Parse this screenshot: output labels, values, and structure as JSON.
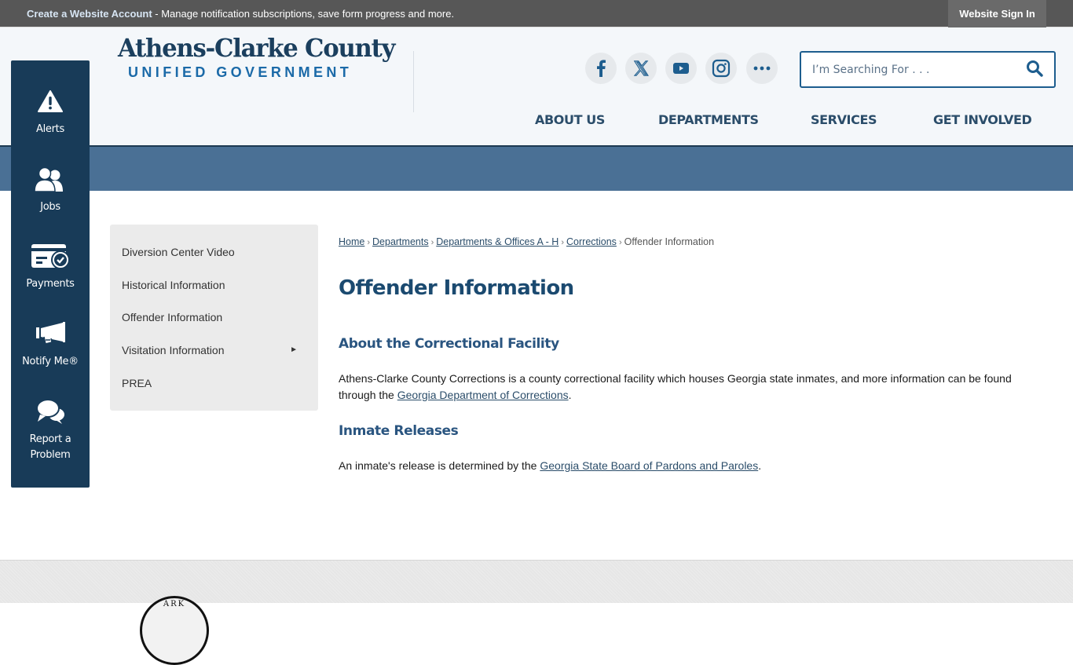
{
  "topbar": {
    "create_account_link": "Create a Website Account",
    "message": " - Manage notification subscriptions, save form progress and more.",
    "sign_in_label": "Website Sign In"
  },
  "logo": {
    "line1": "Athens-Clarke County",
    "line2": "UNIFIED GOVERNMENT"
  },
  "social": [
    {
      "name": "facebook-icon",
      "label": "Facebook"
    },
    {
      "name": "x-twitter-icon",
      "label": "X"
    },
    {
      "name": "youtube-icon",
      "label": "YouTube"
    },
    {
      "name": "instagram-icon",
      "label": "Instagram"
    },
    {
      "name": "more-icon",
      "label": "More"
    }
  ],
  "search": {
    "placeholder": "I’m Searching For . . .",
    "value": "",
    "button_icon": "search-icon"
  },
  "nav": {
    "items": [
      "ABOUT US",
      "DEPARTMENTS",
      "SERVICES",
      "GET INVOLVED"
    ]
  },
  "rail": {
    "items": [
      {
        "label": "Alerts",
        "icon": "alert-triangle-icon"
      },
      {
        "label": "Jobs",
        "icon": "people-icon"
      },
      {
        "label": "Payments",
        "icon": "payment-card-icon"
      },
      {
        "label": "Notify Me®",
        "icon": "megaphone-icon"
      },
      {
        "label_line1": "Report a",
        "label_line2": "Problem",
        "icon": "chat-bubbles-icon"
      }
    ]
  },
  "subnav": {
    "items": [
      {
        "label": "Diversion Center Video"
      },
      {
        "label": "Historical Information"
      },
      {
        "label": "Offender Information"
      },
      {
        "label": "Visitation Information",
        "has_submenu": true,
        "arrow": "►"
      },
      {
        "label": "PREA"
      }
    ]
  },
  "breadcrumb": {
    "links": [
      "Home",
      "Departments",
      "Departments & Offices A - H",
      "Corrections"
    ],
    "separator": "›",
    "current": "Offender Information"
  },
  "content": {
    "title": "Offender Information",
    "section1": {
      "heading": "About the Correctional Facility",
      "text_before": "Athens-Clarke County Corrections is a county correctional facility which houses Georgia state inmates, and more information can be found through the ",
      "link": "Georgia Department of Corrections",
      "text_after": "."
    },
    "section2": {
      "heading": "Inmate Releases",
      "text_before": "An inmate's release is determined by the ",
      "link": "Georgia State Board of Pardons and Paroles",
      "text_after": "."
    }
  },
  "footer": {
    "seal_text": "ARK"
  },
  "colors": {
    "topbar_bg": "#575757",
    "rail_bg": "#183b58",
    "banner_bg": "#4a7095",
    "heading": "#1b4a70",
    "link": "#2b4d6a",
    "accent_blue": "#1b6aa8"
  }
}
